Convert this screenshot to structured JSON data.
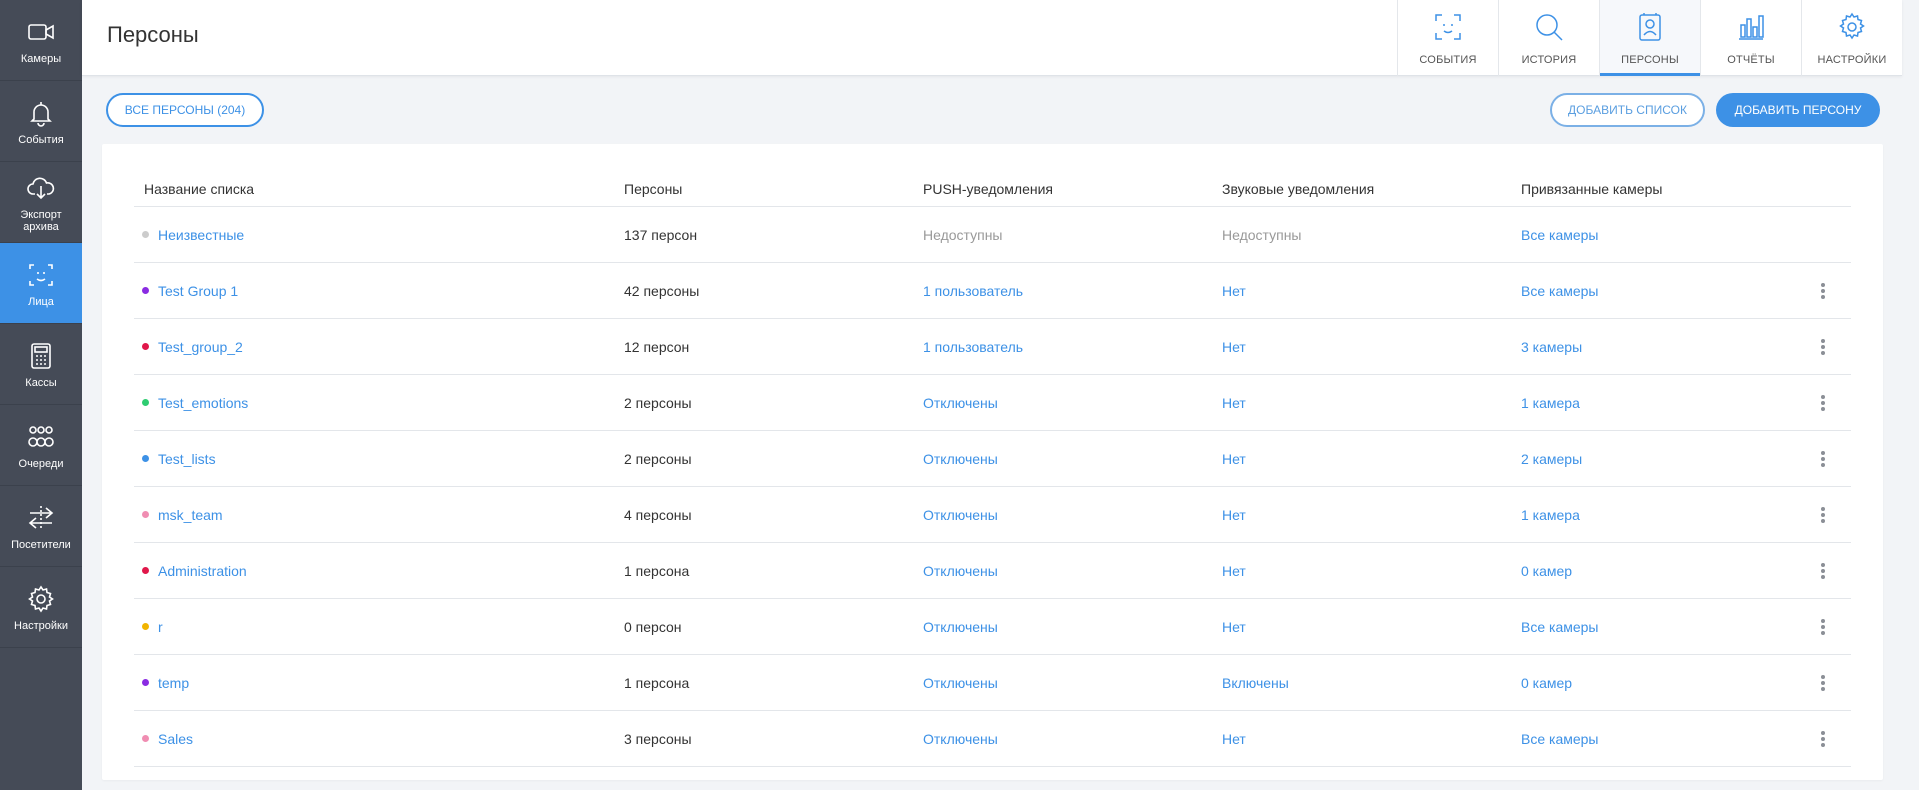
{
  "sidebar": {
    "items": [
      {
        "label": "Камеры",
        "icon": "camera-icon"
      },
      {
        "label": "События",
        "icon": "bell-icon"
      },
      {
        "label": "Экспорт\nархива",
        "icon": "cloud-download-icon"
      },
      {
        "label": "Лица",
        "icon": "face-scan-icon"
      },
      {
        "label": "Кассы",
        "icon": "cash-register-icon"
      },
      {
        "label": "Очереди",
        "icon": "queue-icon"
      },
      {
        "label": "Посетители",
        "icon": "visitors-icon"
      },
      {
        "label": "Настройки",
        "icon": "gear-icon"
      }
    ]
  },
  "header": {
    "title": "Персоны",
    "nav": [
      {
        "label": "СОБЫТИЯ",
        "icon": "face-scan-icon"
      },
      {
        "label": "ИСТОРИЯ",
        "icon": "search-icon"
      },
      {
        "label": "ПЕРСОНЫ",
        "icon": "person-card-icon"
      },
      {
        "label": "ОТЧЁТЫ",
        "icon": "bar-chart-icon"
      },
      {
        "label": "НАСТРОЙКИ",
        "icon": "gear-icon"
      }
    ]
  },
  "toolbar": {
    "all_persons": "ВСЕ ПЕРСОНЫ (204)",
    "add_list": "ДОБАВИТЬ СПИСОК",
    "add_person": "ДОБАВИТЬ ПЕРСОНУ"
  },
  "table": {
    "columns": [
      "Название списка",
      "Персоны",
      "PUSH-уведомления",
      "Звуковые уведомления",
      "Привязанные камеры"
    ],
    "rows": [
      {
        "name": "Неизвестные",
        "color": "#cccccc",
        "persons": "137 персон",
        "push": "Недоступны",
        "sound": "Недоступны",
        "cameras": "Все камеры"
      },
      {
        "name": "Test Group 1",
        "color": "#8a2be2",
        "persons": "42 персоны",
        "push": "1 пользователь",
        "sound": "Нет",
        "cameras": "Все камеры"
      },
      {
        "name": "Test_group_2",
        "color": "#e0174a",
        "persons": "12 персон",
        "push": "1 пользователь",
        "sound": "Нет",
        "cameras": "3 камеры"
      },
      {
        "name": "Test_emotions",
        "color": "#2ecc71",
        "persons": "2 персоны",
        "push": "Отключены",
        "sound": "Нет",
        "cameras": "1 камера"
      },
      {
        "name": "Test_lists",
        "color": "#3d91e6",
        "persons": "2 персоны",
        "push": "Отключены",
        "sound": "Нет",
        "cameras": "2 камеры"
      },
      {
        "name": "msk_team",
        "color": "#f08db2",
        "persons": "4 персоны",
        "push": "Отключены",
        "sound": "Нет",
        "cameras": "1 камера"
      },
      {
        "name": "Administration",
        "color": "#e0174a",
        "persons": "1 персона",
        "push": "Отключены",
        "sound": "Нет",
        "cameras": "0 камер"
      },
      {
        "name": "r",
        "color": "#f1b400",
        "persons": "0 персон",
        "push": "Отключены",
        "sound": "Нет",
        "cameras": "Все камеры"
      },
      {
        "name": "temp",
        "color": "#8a2be2",
        "persons": "1 персона",
        "push": "Отключены",
        "sound": "Включены",
        "cameras": "0 камер"
      },
      {
        "name": "Sales",
        "color": "#f08db2",
        "persons": "3 персоны",
        "push": "Отключены",
        "sound": "Нет",
        "cameras": "Все камеры"
      }
    ]
  }
}
